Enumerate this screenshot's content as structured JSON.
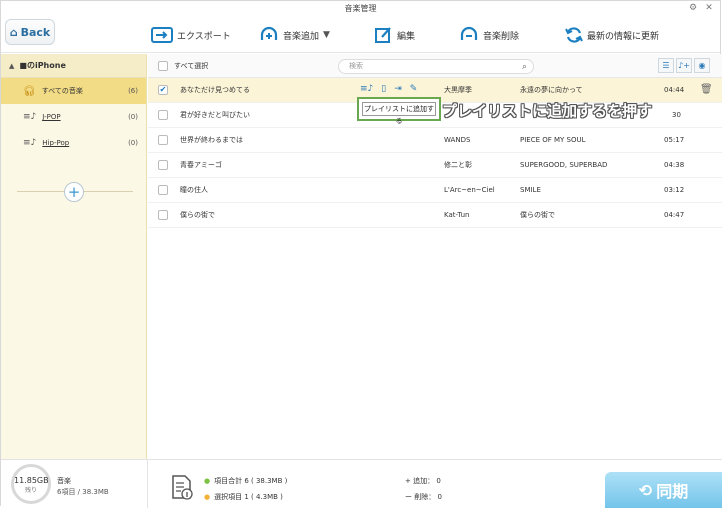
{
  "window": {
    "title": "音楽管理"
  },
  "toolbar": {
    "back_label": "Back",
    "export_label": "エクスポート",
    "add_music_label": "音楽追加",
    "edit_label": "編集",
    "delete_label": "音楽削除",
    "refresh_label": "最新の情報に更新"
  },
  "sidebar": {
    "device_name": "■のiPhone",
    "items": [
      {
        "label": "すべての音楽",
        "count": "(6)"
      },
      {
        "label": "J-POP",
        "count": "(0)"
      },
      {
        "label": "Hip-Pop",
        "count": "(0)"
      }
    ],
    "add_label": "+"
  },
  "list": {
    "select_all_label": "すべて選択",
    "search_placeholder": "検索",
    "rows": [
      {
        "title": "あなただけ見つめてる",
        "artist": "大黒摩季",
        "album": "永遠の夢に向かって",
        "time": "04:44",
        "checked": true
      },
      {
        "title": "君が好きだと叫びたい",
        "artist": "",
        "album": "",
        "time": "30",
        "checked": false
      },
      {
        "title": "世界が終わるまでは",
        "artist": "WANDS",
        "album": "PIECE OF MY SOUL",
        "time": "05:17",
        "checked": false
      },
      {
        "title": "青春アミーゴ",
        "artist": "修二と彰",
        "album": "SUPERGOOD, SUPERBAD",
        "time": "04:38",
        "checked": false
      },
      {
        "title": "瞳の住人",
        "artist": "L'Arc~en~Ciel",
        "album": "SMILE",
        "time": "03:12",
        "checked": false
      },
      {
        "title": "僕らの街で",
        "artist": "Kat-Tun",
        "album": "僕らの街で",
        "time": "04:47",
        "checked": false
      }
    ]
  },
  "tooltip": {
    "text": "プレイリストに追加する"
  },
  "callout": {
    "text": "プレイリストに追加するを押す"
  },
  "footer": {
    "storage_free": "11.85GB",
    "storage_free_label": "残り",
    "music_label": "音楽",
    "music_count": "6項目 / 38.3MB",
    "total_items": "項目合計 6 ( 38.3MB )",
    "selected_items": "選択項目 1 ( 4.3MB )",
    "added": "+ 追加： 0",
    "deleted": "ー 削除： 0",
    "sync_label": "同期"
  },
  "colors": {
    "sidebar_bg": "#fcf8e6",
    "sidebar_active": "#f3dc86",
    "accent_blue": "#1b7fc2",
    "selected_row": "#fbf4d7",
    "callout_border": "#6aa84f"
  }
}
